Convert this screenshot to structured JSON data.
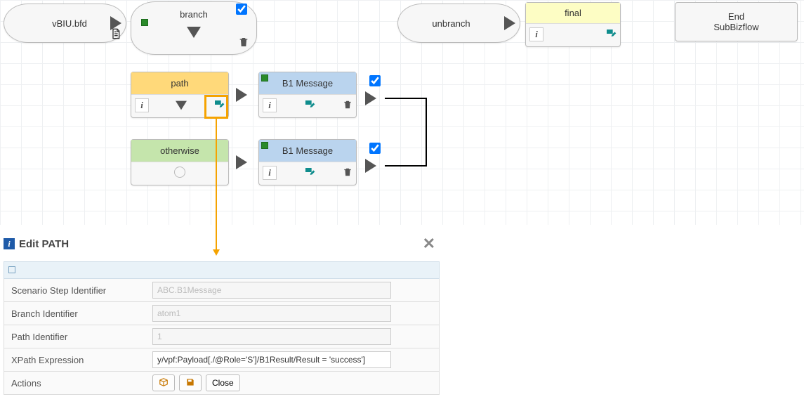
{
  "flow": {
    "vbiu_node": {
      "label": "vBIU.bfd"
    },
    "branch_node": {
      "label": "branch"
    },
    "unbranch_node": {
      "label": "unbranch"
    },
    "final_node": {
      "label": "final"
    },
    "end_node": {
      "line1": "End",
      "line2": "SubBizflow"
    },
    "path_node": {
      "label": "path"
    },
    "otherwise_node": {
      "label": "otherwise"
    },
    "b1_msg1": {
      "label": "B1 Message"
    },
    "b1_msg2": {
      "label": "B1 Message"
    }
  },
  "panel": {
    "title": "Edit PATH",
    "fields": {
      "scenario_label": "Scenario Step Identifier",
      "scenario_placeholder": "ABC.B1Message",
      "branchid_label": "Branch Identifier",
      "branchid_placeholder": "atom1",
      "pathid_label": "Path Identifier",
      "pathid_placeholder": "1",
      "xpath_label": "XPath Expression",
      "xpath_value": "y/vpf:Payload[./@Role='S']/B1Result/Result = 'success']",
      "actions_label": "Actions",
      "close_btn": "Close"
    }
  },
  "colors": {
    "path_bg": "#ffd97a",
    "otherwise_bg": "#c5e5ac",
    "b1msg_bg": "#bad4ee",
    "final_bg": "#fdfdc4",
    "teal": "#0f8d8d",
    "orange": "#f5a300"
  }
}
